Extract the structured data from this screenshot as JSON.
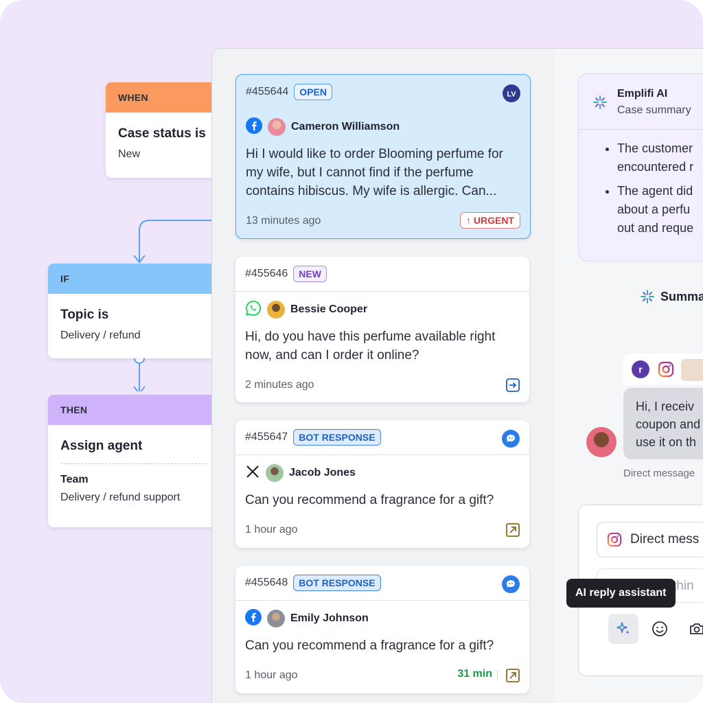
{
  "workflow": {
    "when": {
      "label": "WHEN",
      "title": "Case status is",
      "value": "New",
      "color": "#fb9a5e"
    },
    "if": {
      "label": "IF",
      "title": "Topic is",
      "value": "Delivery / refund",
      "color": "#86c5fb"
    },
    "then": {
      "label": "THEN",
      "title": "Assign agent",
      "team_label": "Team",
      "team_value": "Delivery / refund support",
      "color": "#cfb3fa"
    }
  },
  "cases": [
    {
      "id": "#455644",
      "badge": "OPEN",
      "channel_icon": "facebook-icon",
      "user": "Cameron Williamson",
      "message": "Hi I would like to order Blooming perfume for my wife, but I cannot find if the perfume contains hibiscus. My wife is allergic. Can...",
      "time": "13 minutes ago",
      "priority": "URGENT",
      "assignee_initials": "LV"
    },
    {
      "id": "#455646",
      "badge": "NEW",
      "channel_icon": "whatsapp-icon",
      "user": "Bessie Cooper",
      "message": "Hi, do you have this perfume available right now, and can I order it online?",
      "time": "2 minutes ago"
    },
    {
      "id": "#455647",
      "badge": "BOT RESPONSE",
      "channel_icon": "x-icon",
      "user": "Jacob Jones",
      "message": "Can you recommend a fragrance for a gift?",
      "time": "1 hour ago"
    },
    {
      "id": "#455648",
      "badge": "BOT RESPONSE",
      "channel_icon": "facebook-icon",
      "user": "Emily Johnson",
      "message": "Can you recommend a fragrance for a gift?",
      "time": "1 hour ago",
      "sla": "31 min"
    }
  ],
  "ai_summary": {
    "name": "Emplifi AI",
    "subtitle": "Case summary",
    "bullets": [
      "The customer encountered r",
      "The agent did about a perfu out and reque"
    ],
    "bullet1_lines": [
      "The customer",
      "encountered r"
    ],
    "bullet2_lines": [
      "The agent did",
      "about a perfu",
      "out and reque"
    ]
  },
  "summarize_label": "Summa",
  "chat": {
    "bubble_lines": [
      "Hi, I receiv",
      "coupon and",
      "use it on th"
    ],
    "meta": "Direct message"
  },
  "composer": {
    "channel": "Direct mess",
    "placeholder": "thin"
  },
  "tooltip": "AI reply assistant"
}
